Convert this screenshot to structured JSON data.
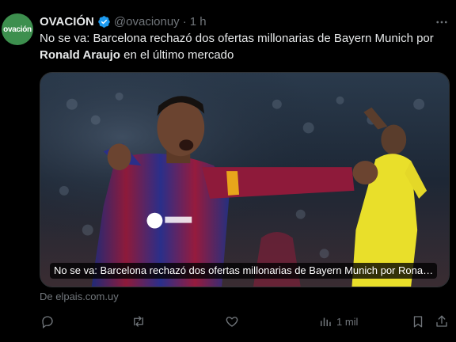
{
  "author": {
    "avatar_text": "ovación",
    "name": "OVACIÓN",
    "handle": "@ovacionuy",
    "separator": "·",
    "time": "1 h"
  },
  "tweet": {
    "text_part1": "No se va: Barcelona rechazó dos ofertas millonarias de Bayern Munich por",
    "text_bold": "Ronald Araujo",
    "text_part2": "en el último mercado"
  },
  "card": {
    "caption": "No se va: Barcelona rechazó dos ofertas millonarias de Bayern Munich por Rona…",
    "source": "De elpais.com.uy"
  },
  "actions": {
    "views_count": "1 mil"
  },
  "icons": {
    "verified": "verified-badge-icon",
    "more": "more-icon",
    "reply": "reply-icon",
    "retweet": "retweet-icon",
    "like": "like-icon",
    "views": "views-icon",
    "bookmark": "bookmark-icon",
    "share": "share-icon"
  },
  "colors": {
    "background": "#000000",
    "text": "#e7e9ea",
    "muted": "#71767b",
    "verified": "#1d9bf0",
    "avatar": "#3d8f4e"
  }
}
